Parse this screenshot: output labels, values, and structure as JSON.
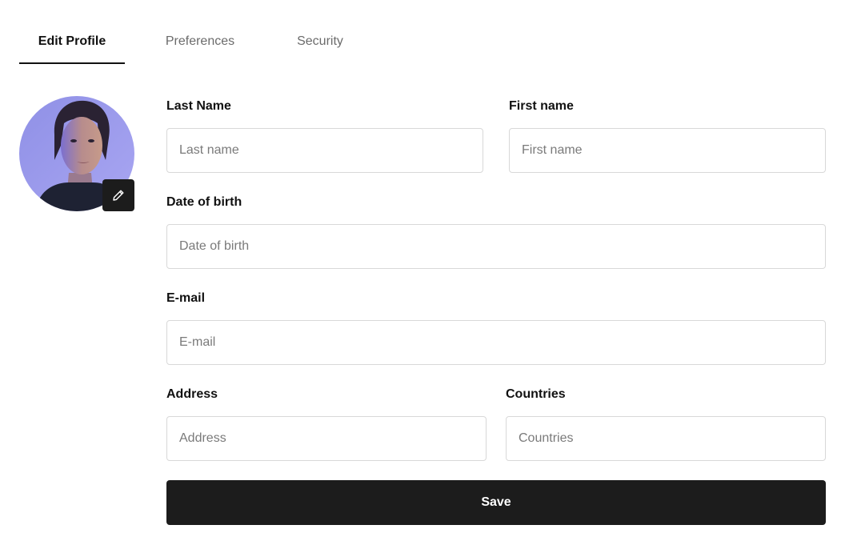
{
  "tabs": [
    {
      "label": "Edit Profile",
      "active": true
    },
    {
      "label": "Preferences",
      "active": false
    },
    {
      "label": "Security",
      "active": false
    }
  ],
  "avatar": {
    "edit_icon": "pencil-icon"
  },
  "form": {
    "last_name": {
      "label": "Last Name",
      "placeholder": "Last name",
      "value": ""
    },
    "first_name": {
      "label": "First name",
      "placeholder": "First name",
      "value": ""
    },
    "date_of_birth": {
      "label": "Date of birth",
      "placeholder": "Date of birth",
      "value": ""
    },
    "email": {
      "label": "E-mail",
      "placeholder": "E-mail",
      "value": ""
    },
    "address": {
      "label": "Address",
      "placeholder": "Address",
      "value": ""
    },
    "countries": {
      "label": "Countries",
      "placeholder": "Countries",
      "value": ""
    },
    "save_label": "Save"
  },
  "colors": {
    "accent": "#1c1c1c",
    "border": "#d8d8d8",
    "muted_text": "#6b6b6b",
    "avatar_background": "#9a9ae8"
  }
}
